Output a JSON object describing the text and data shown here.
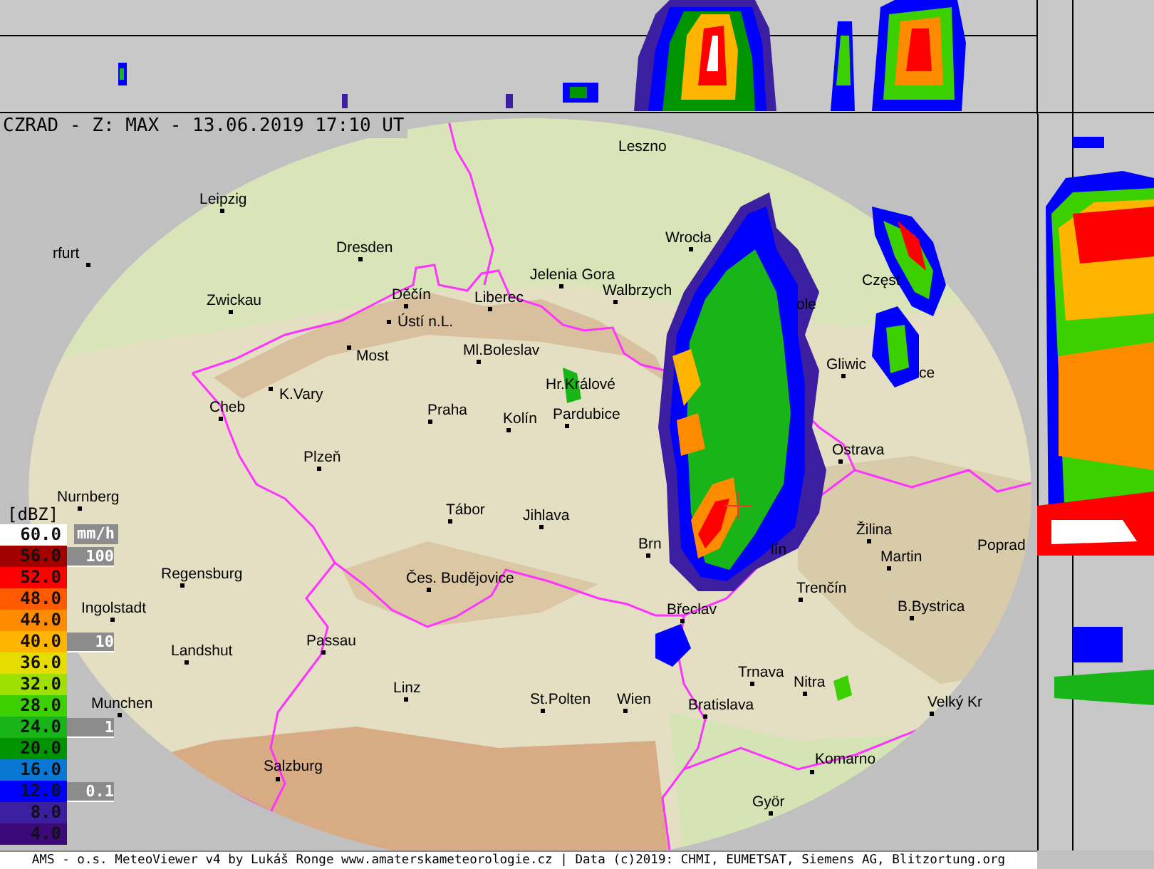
{
  "title": "CZRAD - Z: MAX - 13.06.2019 17:10 UT",
  "legend": {
    "unit": "[dBZ]",
    "rate_unit": "mm/h",
    "classes": [
      {
        "value": "60.0",
        "color": "#ffffff"
      },
      {
        "value": "56.0",
        "color": "#a00000"
      },
      {
        "value": "52.0",
        "color": "#ff0000"
      },
      {
        "value": "48.0",
        "color": "#ff5a00"
      },
      {
        "value": "44.0",
        "color": "#ff8c00"
      },
      {
        "value": "40.0",
        "color": "#ffb400"
      },
      {
        "value": "36.0",
        "color": "#e6dc00"
      },
      {
        "value": "32.0",
        "color": "#a0e000"
      },
      {
        "value": "28.0",
        "color": "#3cd000"
      },
      {
        "value": "24.0",
        "color": "#18b418"
      },
      {
        "value": "20.0",
        "color": "#009400"
      },
      {
        "value": "16.0",
        "color": "#0a78d2"
      },
      {
        "value": "12.0",
        "color": "#0000ff"
      },
      {
        "value": "8.0",
        "color": "#3c1ea0"
      },
      {
        "value": "4.0",
        "color": "#3c0a78"
      }
    ],
    "rate_marks": [
      "100",
      "10",
      "1",
      "0.1"
    ]
  },
  "cities": [
    {
      "name": "Leszno"
    },
    {
      "name": "Leipzig"
    },
    {
      "name": "Dresden"
    },
    {
      "name": "rfurt"
    },
    {
      "name": "Zwickau"
    },
    {
      "name": "Děčín"
    },
    {
      "name": "Ústí n.L."
    },
    {
      "name": "Liberec"
    },
    {
      "name": "Jelenia Gora"
    },
    {
      "name": "Walbrzych"
    },
    {
      "name": "Wrocła"
    },
    {
      "name": "Most"
    },
    {
      "name": "Ml.Boleslav"
    },
    {
      "name": "K.Vary"
    },
    {
      "name": "Cheb"
    },
    {
      "name": "Hr.Králové"
    },
    {
      "name": "Praha"
    },
    {
      "name": "Kolín"
    },
    {
      "name": "Pardubice"
    },
    {
      "name": "Plzeň"
    },
    {
      "name": "Tábor"
    },
    {
      "name": "Jihlava"
    },
    {
      "name": "Nurnberg"
    },
    {
      "name": "Brn"
    },
    {
      "name": "lín"
    },
    {
      "name": "Regensburg"
    },
    {
      "name": "Ingolstadt"
    },
    {
      "name": "Čes. Budějovice"
    },
    {
      "name": "Břeclav"
    },
    {
      "name": "Trenčín"
    },
    {
      "name": "Žilina"
    },
    {
      "name": "Martin"
    },
    {
      "name": "Poprad"
    },
    {
      "name": "B.Bystrica"
    },
    {
      "name": "Landshut"
    },
    {
      "name": "Passau"
    },
    {
      "name": "Trnava"
    },
    {
      "name": "Nitra"
    },
    {
      "name": "Munchen"
    },
    {
      "name": "Linz"
    },
    {
      "name": "St.Polten"
    },
    {
      "name": "Wien"
    },
    {
      "name": "Bratislava"
    },
    {
      "name": "Velký Kr"
    },
    {
      "name": "Salzburg"
    },
    {
      "name": "Komarno"
    },
    {
      "name": "Györ"
    },
    {
      "name": "Częst"
    },
    {
      "name": "Gliwic"
    },
    {
      "name": "ce"
    },
    {
      "name": "ole"
    },
    {
      "name": "Ostrava"
    }
  ],
  "credits": "AMS - o.s. MeteoViewer v4 by Lukáš Ronge www.amaterskameteorologie.cz | Data (c)2019: CHMI, EUMETSAT, Siemens AG, Blitzortung.org"
}
